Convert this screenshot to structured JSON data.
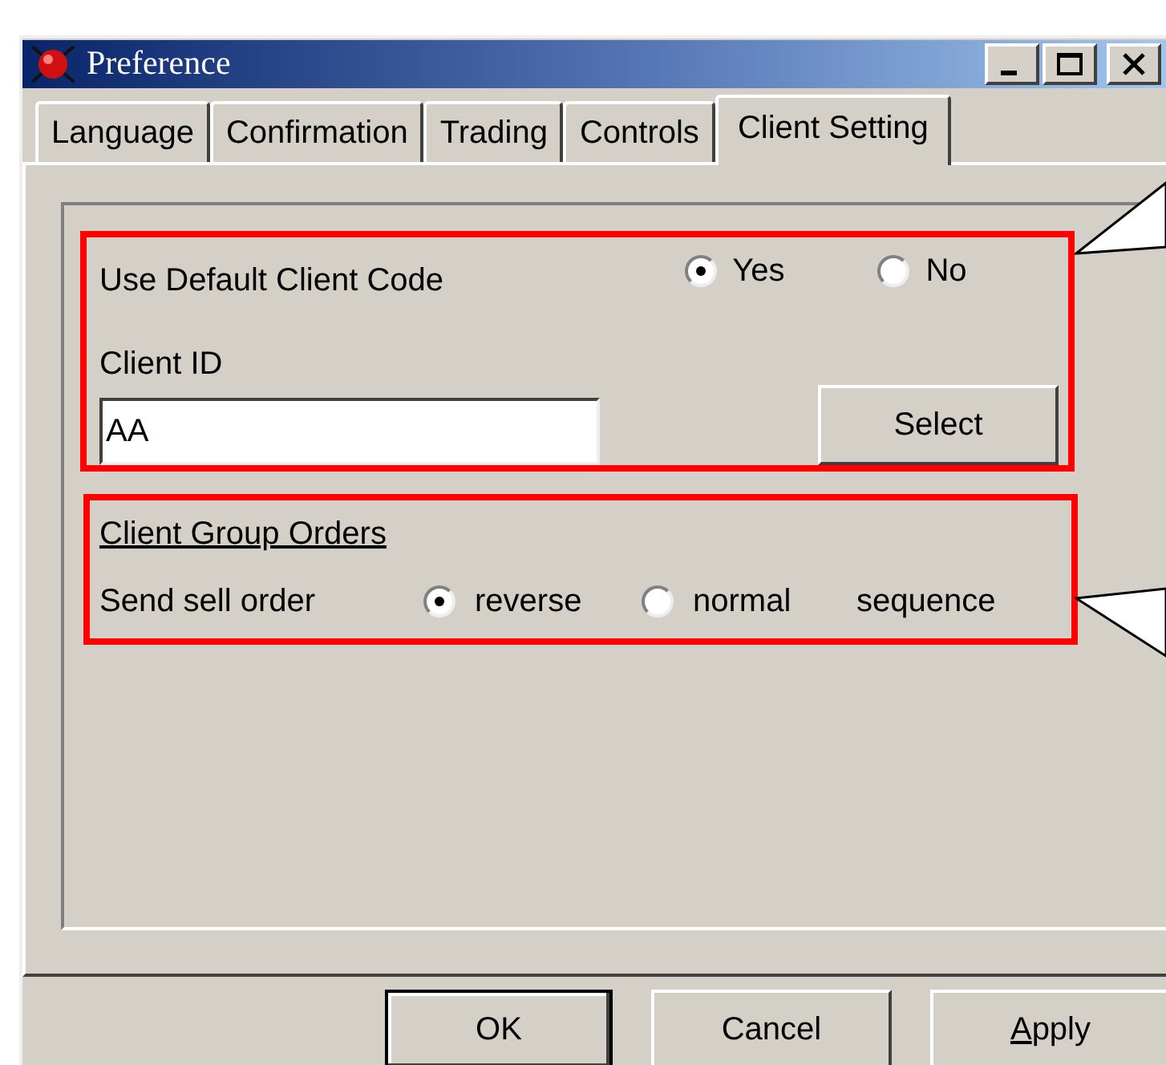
{
  "window": {
    "title": "Preference"
  },
  "tabs": [
    {
      "label": "Language",
      "selected": false
    },
    {
      "label": "Confirmation",
      "selected": false
    },
    {
      "label": "Trading",
      "selected": false
    },
    {
      "label": "Controls",
      "selected": false
    },
    {
      "label": "Client Setting",
      "selected": true
    }
  ],
  "default_client_code": {
    "label": "Use Default Client Code",
    "options": [
      {
        "label": "Yes",
        "selected": true
      },
      {
        "label": "No",
        "selected": false
      }
    ]
  },
  "client_id": {
    "label": "Client ID",
    "value": "AA",
    "button": "Select"
  },
  "client_group_orders": {
    "title": "Client Group Orders",
    "label": "Send sell order",
    "options": [
      {
        "label": "reverse",
        "selected": true
      },
      {
        "label": "normal",
        "selected": false
      }
    ],
    "suffix": "sequence"
  },
  "buttons": [
    {
      "label": "OK",
      "default": true,
      "access_key_underlined": false
    },
    {
      "label": "Cancel",
      "default": false,
      "access_key_underlined": false
    },
    {
      "label": "Apply",
      "default": false,
      "access_key_underlined": true
    }
  ]
}
